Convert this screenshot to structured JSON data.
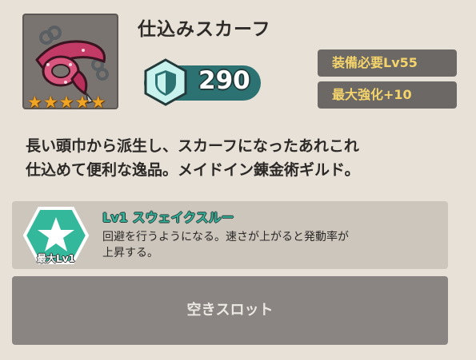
{
  "item": {
    "name": "仕込みスカーフ",
    "rarity_stars": 5,
    "icon": "scarf-item-icon",
    "frame_color": "#7a7470"
  },
  "stats": {
    "defense_icon": "shield-icon",
    "defense_value": "290"
  },
  "requirements": {
    "equip_level": "装備必要Lv55",
    "max_enhance": "最大強化+10"
  },
  "description": {
    "line1": "長い頭巾から派生し、スカーフになったあれこれ",
    "line2": "仕込めて便利な逸品。メイドイン錬金術ギルド。"
  },
  "skill": {
    "icon": "star-hexagon-icon",
    "max_level_label": "最大Lv1",
    "title": "Lv1 スウェイクスルー",
    "desc_line1": "回避を行うようになる。速さが上がると発動率が",
    "desc_line2": "上昇する。"
  },
  "slot": {
    "label": "空きスロット"
  },
  "colors": {
    "background": "#e7e1d8",
    "defense_pill": "#2d7272",
    "requirement_text": "#f5d56b",
    "skill_title": "#35b29a",
    "star": "#f0a524"
  }
}
